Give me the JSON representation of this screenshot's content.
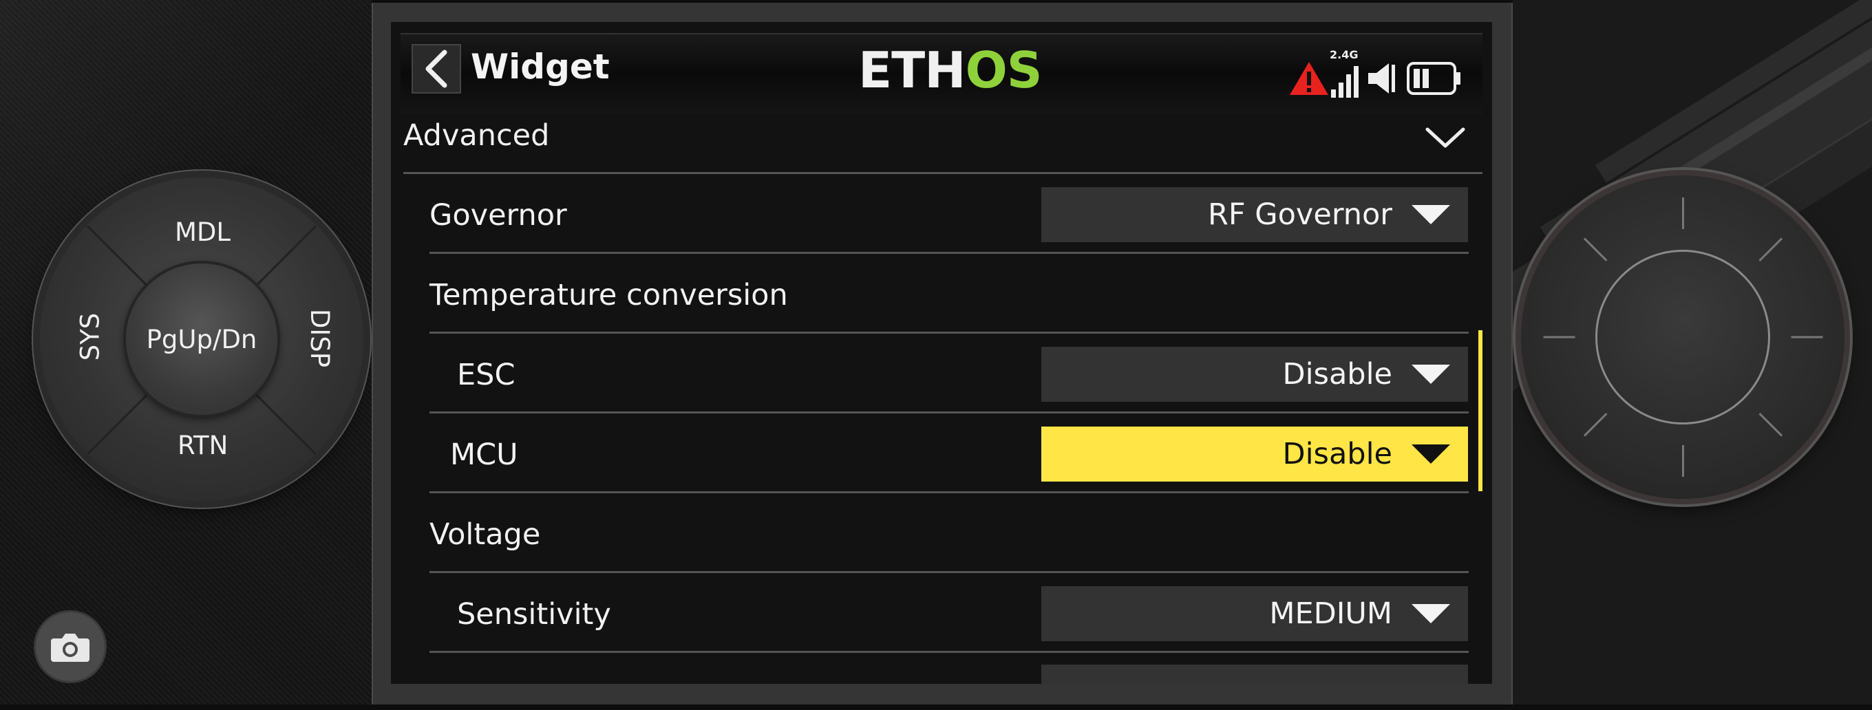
{
  "remote": {
    "dpad": {
      "top": "MDL",
      "left": "SYS",
      "right": "DISP",
      "bottom": "RTN",
      "center": "PgUp/Dn"
    },
    "camera_icon": "camera-icon",
    "knob_icon": "rotary-knob"
  },
  "header": {
    "title": "Widget",
    "logo_left": "ETH",
    "logo_right": "OS",
    "signal_label": "2.4G",
    "icons": [
      "back-icon",
      "warning-icon",
      "signal-icon",
      "volume-icon",
      "battery-icon"
    ]
  },
  "section": {
    "title": "Advanced",
    "expanded": true
  },
  "rows": {
    "governor": {
      "label": "Governor",
      "value": "RF Governor"
    },
    "temperature_conversion": {
      "label": "Temperature conversion"
    },
    "esc": {
      "label": "ESC",
      "value": "Disable"
    },
    "mcu": {
      "label": "MCU",
      "value": "Disable",
      "selected": true
    },
    "voltage": {
      "label": "Voltage"
    },
    "sensitivity": {
      "label": "Sensitivity",
      "value": "MEDIUM"
    }
  },
  "colors": {
    "accent_yellow": "#ffe545",
    "logo_green": "#8ed13a",
    "warning_red": "#e8231f",
    "dropdown_bg": "#333333",
    "screen_bg": "#121212"
  }
}
